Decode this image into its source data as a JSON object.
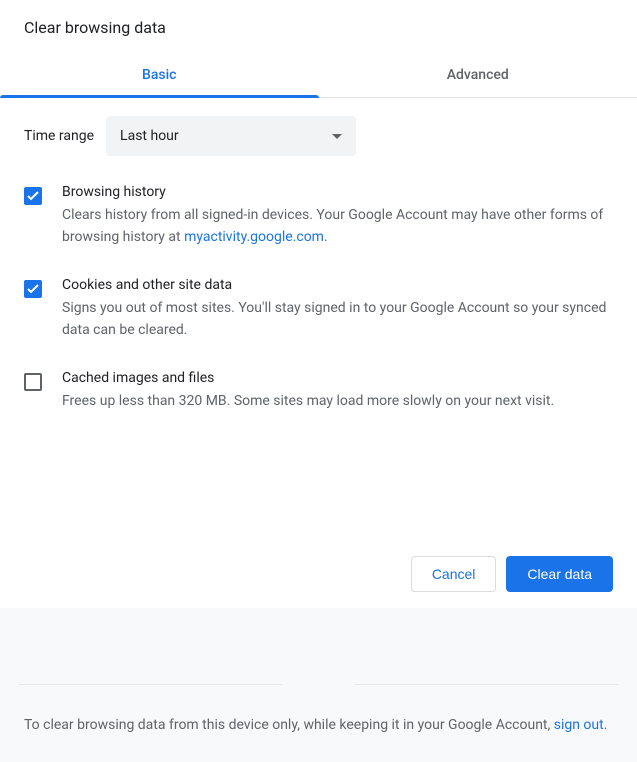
{
  "dialog": {
    "title": "Clear browsing data",
    "tabs": {
      "basic": "Basic",
      "advanced": "Advanced"
    },
    "time_range": {
      "label": "Time range",
      "value": "Last hour"
    },
    "items": [
      {
        "title": "Browsing history",
        "desc_pre": "Clears history from all signed-in devices. Your Google Account may have other forms of browsing history at ",
        "link": "myactivity.google.com",
        "desc_post": ".",
        "checked": true
      },
      {
        "title": "Cookies and other site data",
        "desc_pre": "Signs you out of most sites. You'll stay signed in to your Google Account so your synced data can be cleared.",
        "link": "",
        "desc_post": "",
        "checked": true
      },
      {
        "title": "Cached images and files",
        "desc_pre": "Frees up less than 320 MB. Some sites may load more slowly on your next visit.",
        "link": "",
        "desc_post": "",
        "checked": false
      }
    ],
    "buttons": {
      "cancel": "Cancel",
      "confirm": "Clear data"
    },
    "footer": {
      "text_pre": "To clear browsing data from this device only, while keeping it in your Google Account, ",
      "link": "sign out",
      "text_post": "."
    }
  }
}
